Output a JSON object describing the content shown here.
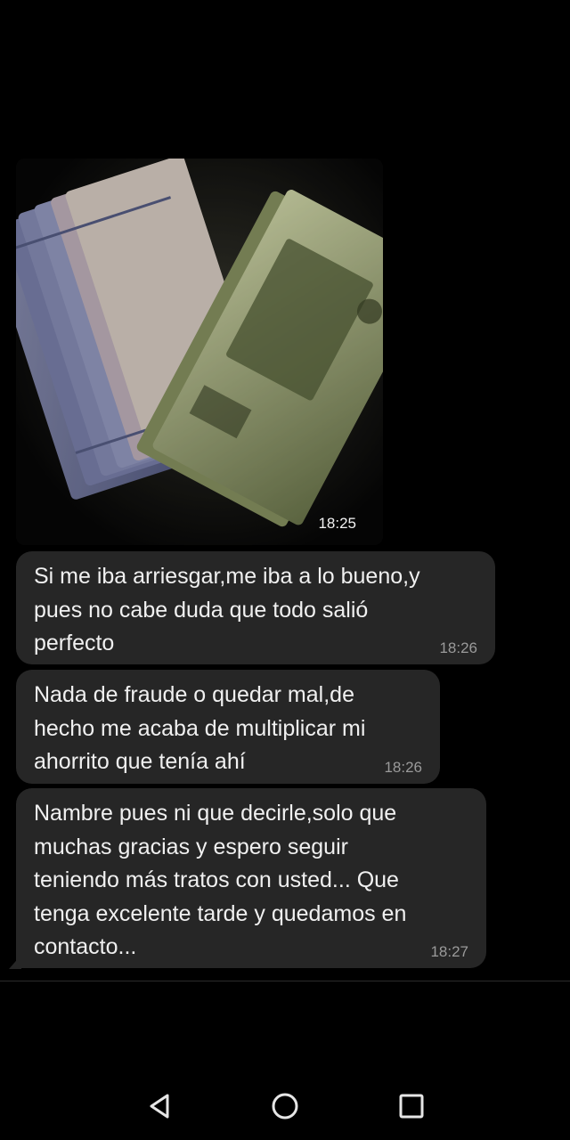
{
  "messages": [
    {
      "type": "image",
      "image_icon": "photo-of-mexican-peso-banknotes",
      "time": "18:25"
    },
    {
      "type": "text",
      "text": "Si me iba arriesgar,me iba a lo bueno,y\npues no cabe duda que todo salió\nperfecto",
      "time": "18:26"
    },
    {
      "type": "text",
      "text": "Nada de fraude o quedar mal,de\nhecho me acaba de multiplicar mi\nahorrito que tenía ahí",
      "time": "18:26"
    },
    {
      "type": "text",
      "text": "Nambre pues ni que decirle,solo que\nmuchas gracias y espero seguir\nteniendo más tratos con usted... Que\ntenga excelente tarde y quedamos en\ncontacto...",
      "time": "18:27"
    }
  ],
  "nav": {
    "back_icon": "triangle-back-icon",
    "home_icon": "circle-home-icon",
    "recent_icon": "square-recent-apps-icon"
  },
  "colors": {
    "background": "#000000",
    "bubble": "#262626",
    "text": "#f0f0f0",
    "timestamp": "#9a9a9a"
  }
}
